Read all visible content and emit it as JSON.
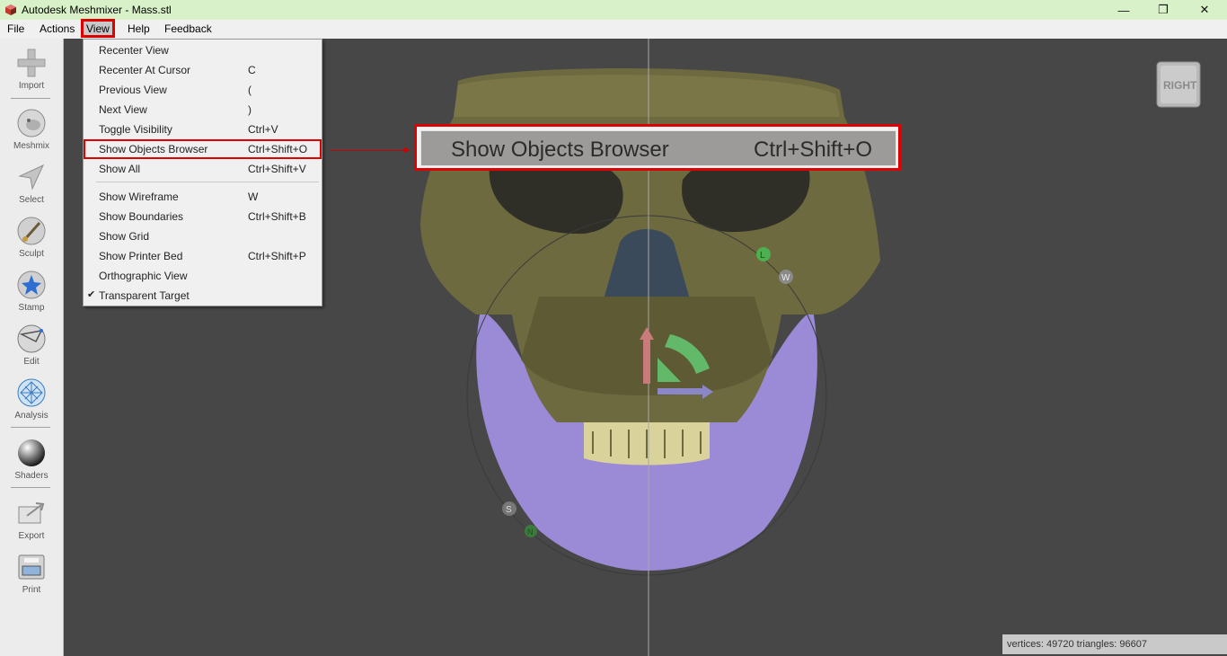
{
  "window": {
    "title": "Autodesk Meshmixer - Mass.stl",
    "minimize": "—",
    "maximize": "❐",
    "close": "✕"
  },
  "menubar": {
    "items": [
      "File",
      "Actions",
      "View",
      "Help",
      "Feedback"
    ],
    "active": "View"
  },
  "sidebar": {
    "tools": [
      {
        "label": "Import",
        "icon": "plus-icon"
      },
      {
        "label": "Meshmix",
        "icon": "bunny-head-icon"
      },
      {
        "label": "Select",
        "icon": "cursor-arrow-icon"
      },
      {
        "label": "Sculpt",
        "icon": "brush-icon"
      },
      {
        "label": "Stamp",
        "icon": "stamp-icon"
      },
      {
        "label": "Edit",
        "icon": "edit-sphere-icon"
      },
      {
        "label": "Analysis",
        "icon": "analysis-sphere-icon"
      },
      {
        "label": "Shaders",
        "icon": "shader-sphere-icon"
      },
      {
        "label": "Export",
        "icon": "export-icon"
      },
      {
        "label": "Print",
        "icon": "printer-icon"
      }
    ]
  },
  "view_menu": {
    "items": [
      {
        "label": "Recenter View",
        "shortcut": ""
      },
      {
        "label": "Recenter At Cursor",
        "shortcut": "C"
      },
      {
        "label": "Previous View",
        "shortcut": "("
      },
      {
        "label": "Next View",
        "shortcut": ")"
      },
      {
        "label": "Toggle Visibility",
        "shortcut": "Ctrl+V"
      },
      {
        "label": "Show Objects Browser",
        "shortcut": "Ctrl+Shift+O"
      },
      {
        "label": "Show All",
        "shortcut": "Ctrl+Shift+V"
      },
      {
        "label": "Show Wireframe",
        "shortcut": "W"
      },
      {
        "label": "Show Boundaries",
        "shortcut": "Ctrl+Shift+B"
      },
      {
        "label": "Show Grid",
        "shortcut": ""
      },
      {
        "label": "Show Printer Bed",
        "shortcut": "Ctrl+Shift+P"
      },
      {
        "label": "Orthographic View",
        "shortcut": ""
      },
      {
        "label": "Transparent Target",
        "shortcut": "",
        "checked": true
      }
    ],
    "highlighted": "Show Objects Browser"
  },
  "callout": {
    "label": "Show Objects Browser",
    "shortcut": "Ctrl+Shift+O"
  },
  "viewport": {
    "nav_cube_label": "RIGHT",
    "gizmo_labels": {
      "l": "L",
      "w": "W",
      "s": "S",
      "n": "N"
    }
  },
  "status": {
    "text": "vertices: 49720 triangles: 96607"
  },
  "colors": {
    "titlebar": "#d9f1c8",
    "highlight": "#e00000",
    "skull": "#6e6a3f",
    "jaw": "#9b8ad6",
    "viewport": "#474747"
  }
}
